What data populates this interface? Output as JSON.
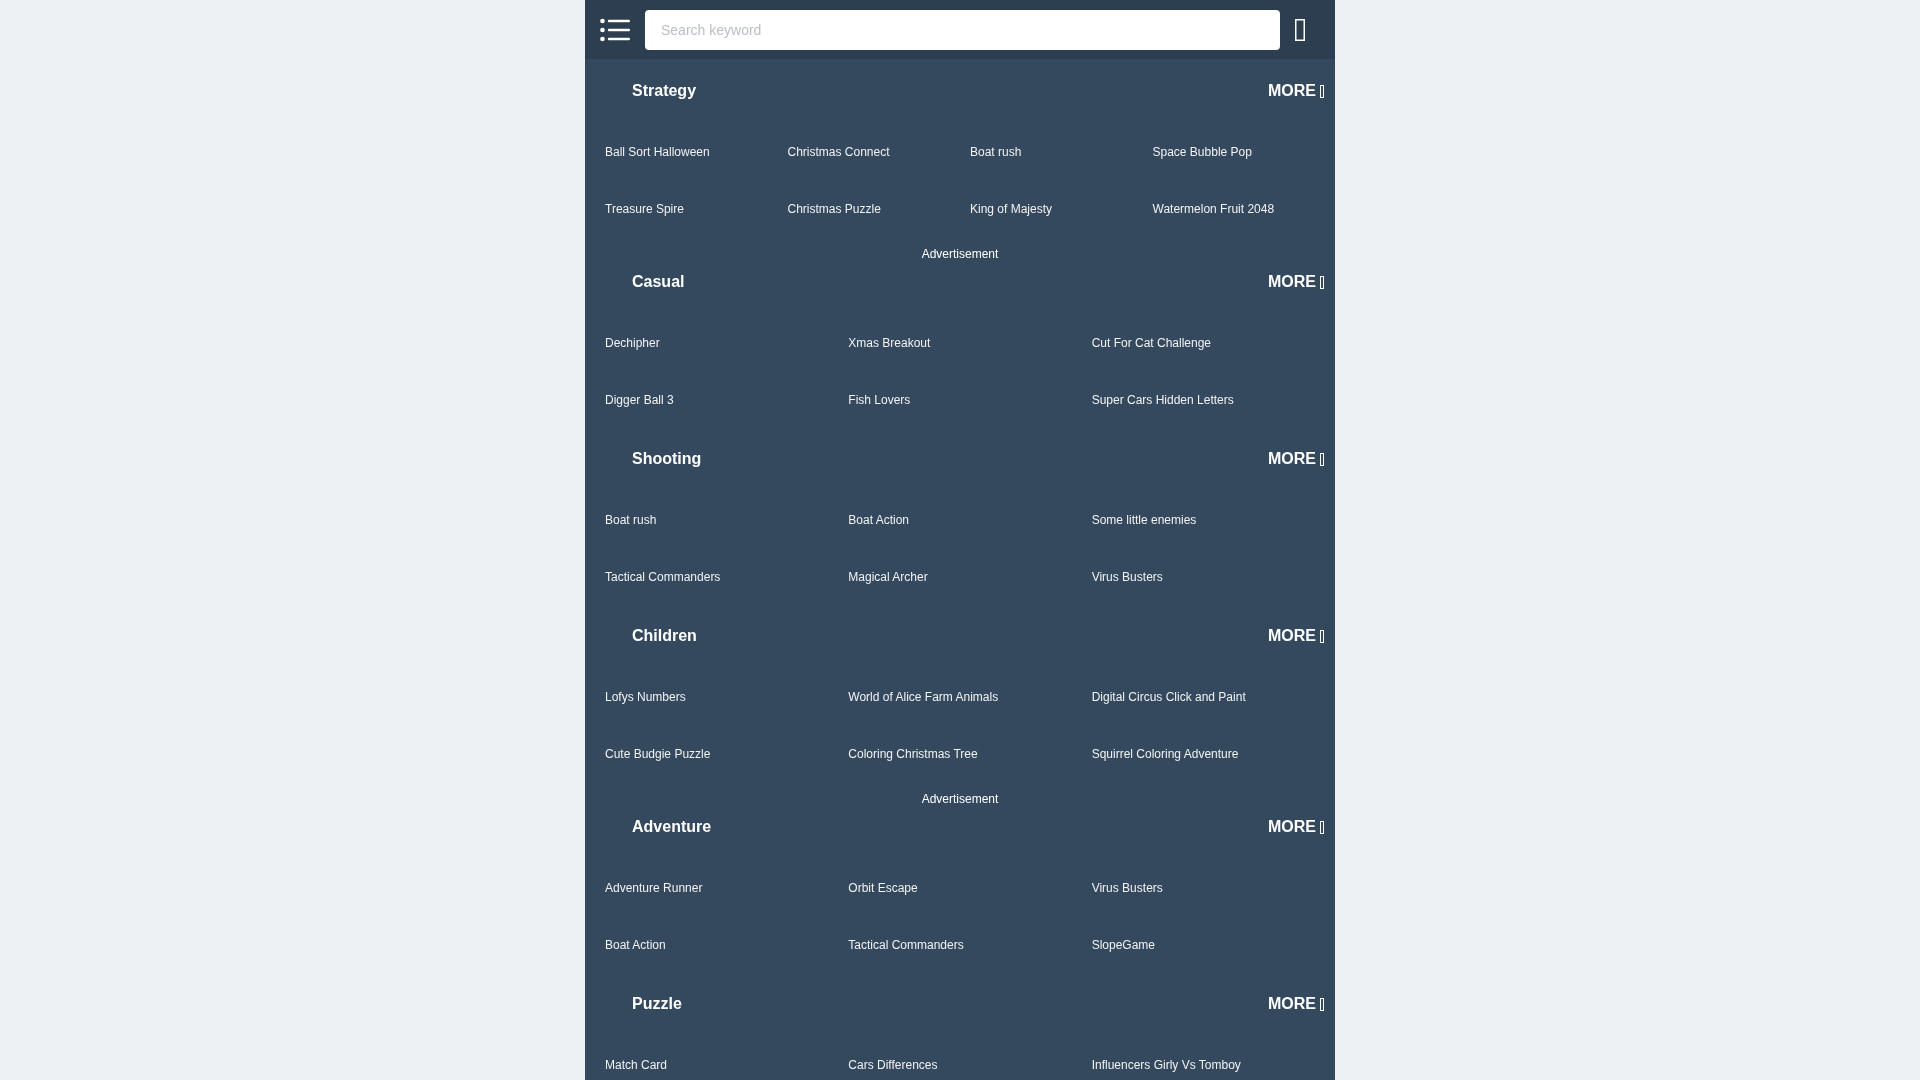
{
  "header": {
    "search": {
      "placeholder": "Search keyword"
    }
  },
  "content": [
    {
      "kind": "section",
      "title": "Strategy",
      "more": "MORE",
      "rows": [
        [
          "Ball Sort Halloween",
          "Christmas Connect",
          "Boat rush",
          "Space Bubble Pop"
        ],
        [
          "Treasure Spire",
          "Christmas Puzzle",
          "King of Majesty",
          "Watermelon Fruit 2048"
        ]
      ]
    },
    {
      "kind": "advertisement",
      "label": "Advertisement"
    },
    {
      "kind": "section",
      "title": "Casual",
      "more": "MORE",
      "rows": [
        [
          "Dechipher",
          "Xmas Breakout",
          "Cut For Cat Challenge"
        ],
        [
          "Digger Ball 3",
          "Fish Lovers",
          "Super Cars Hidden Letters"
        ]
      ]
    },
    {
      "kind": "section",
      "title": "Shooting",
      "more": "MORE",
      "rows": [
        [
          "Boat rush",
          "Boat Action",
          "Some little enemies"
        ],
        [
          "Tactical Commanders",
          "Magical Archer",
          "Virus Busters"
        ]
      ]
    },
    {
      "kind": "section",
      "title": "Children",
      "more": "MORE",
      "rows": [
        [
          "Lofys Numbers",
          "World of Alice Farm Animals",
          "Digital Circus Click and Paint"
        ],
        [
          "Cute Budgie Puzzle",
          "Coloring Christmas Tree",
          "Squirrel Coloring Adventure"
        ]
      ]
    },
    {
      "kind": "advertisement",
      "label": "Advertisement"
    },
    {
      "kind": "section",
      "title": "Adventure",
      "more": "MORE",
      "rows": [
        [
          "Adventure Runner",
          "Orbit Escape",
          "Virus Busters"
        ],
        [
          "Boat Action",
          "Tactical Commanders",
          "SlopeGame"
        ]
      ]
    },
    {
      "kind": "section",
      "title": "Puzzle",
      "more": "MORE",
      "rows": [
        [
          "Match Card",
          "Cars Differences",
          "Influencers Girly Vs Tomboy"
        ]
      ]
    }
  ]
}
